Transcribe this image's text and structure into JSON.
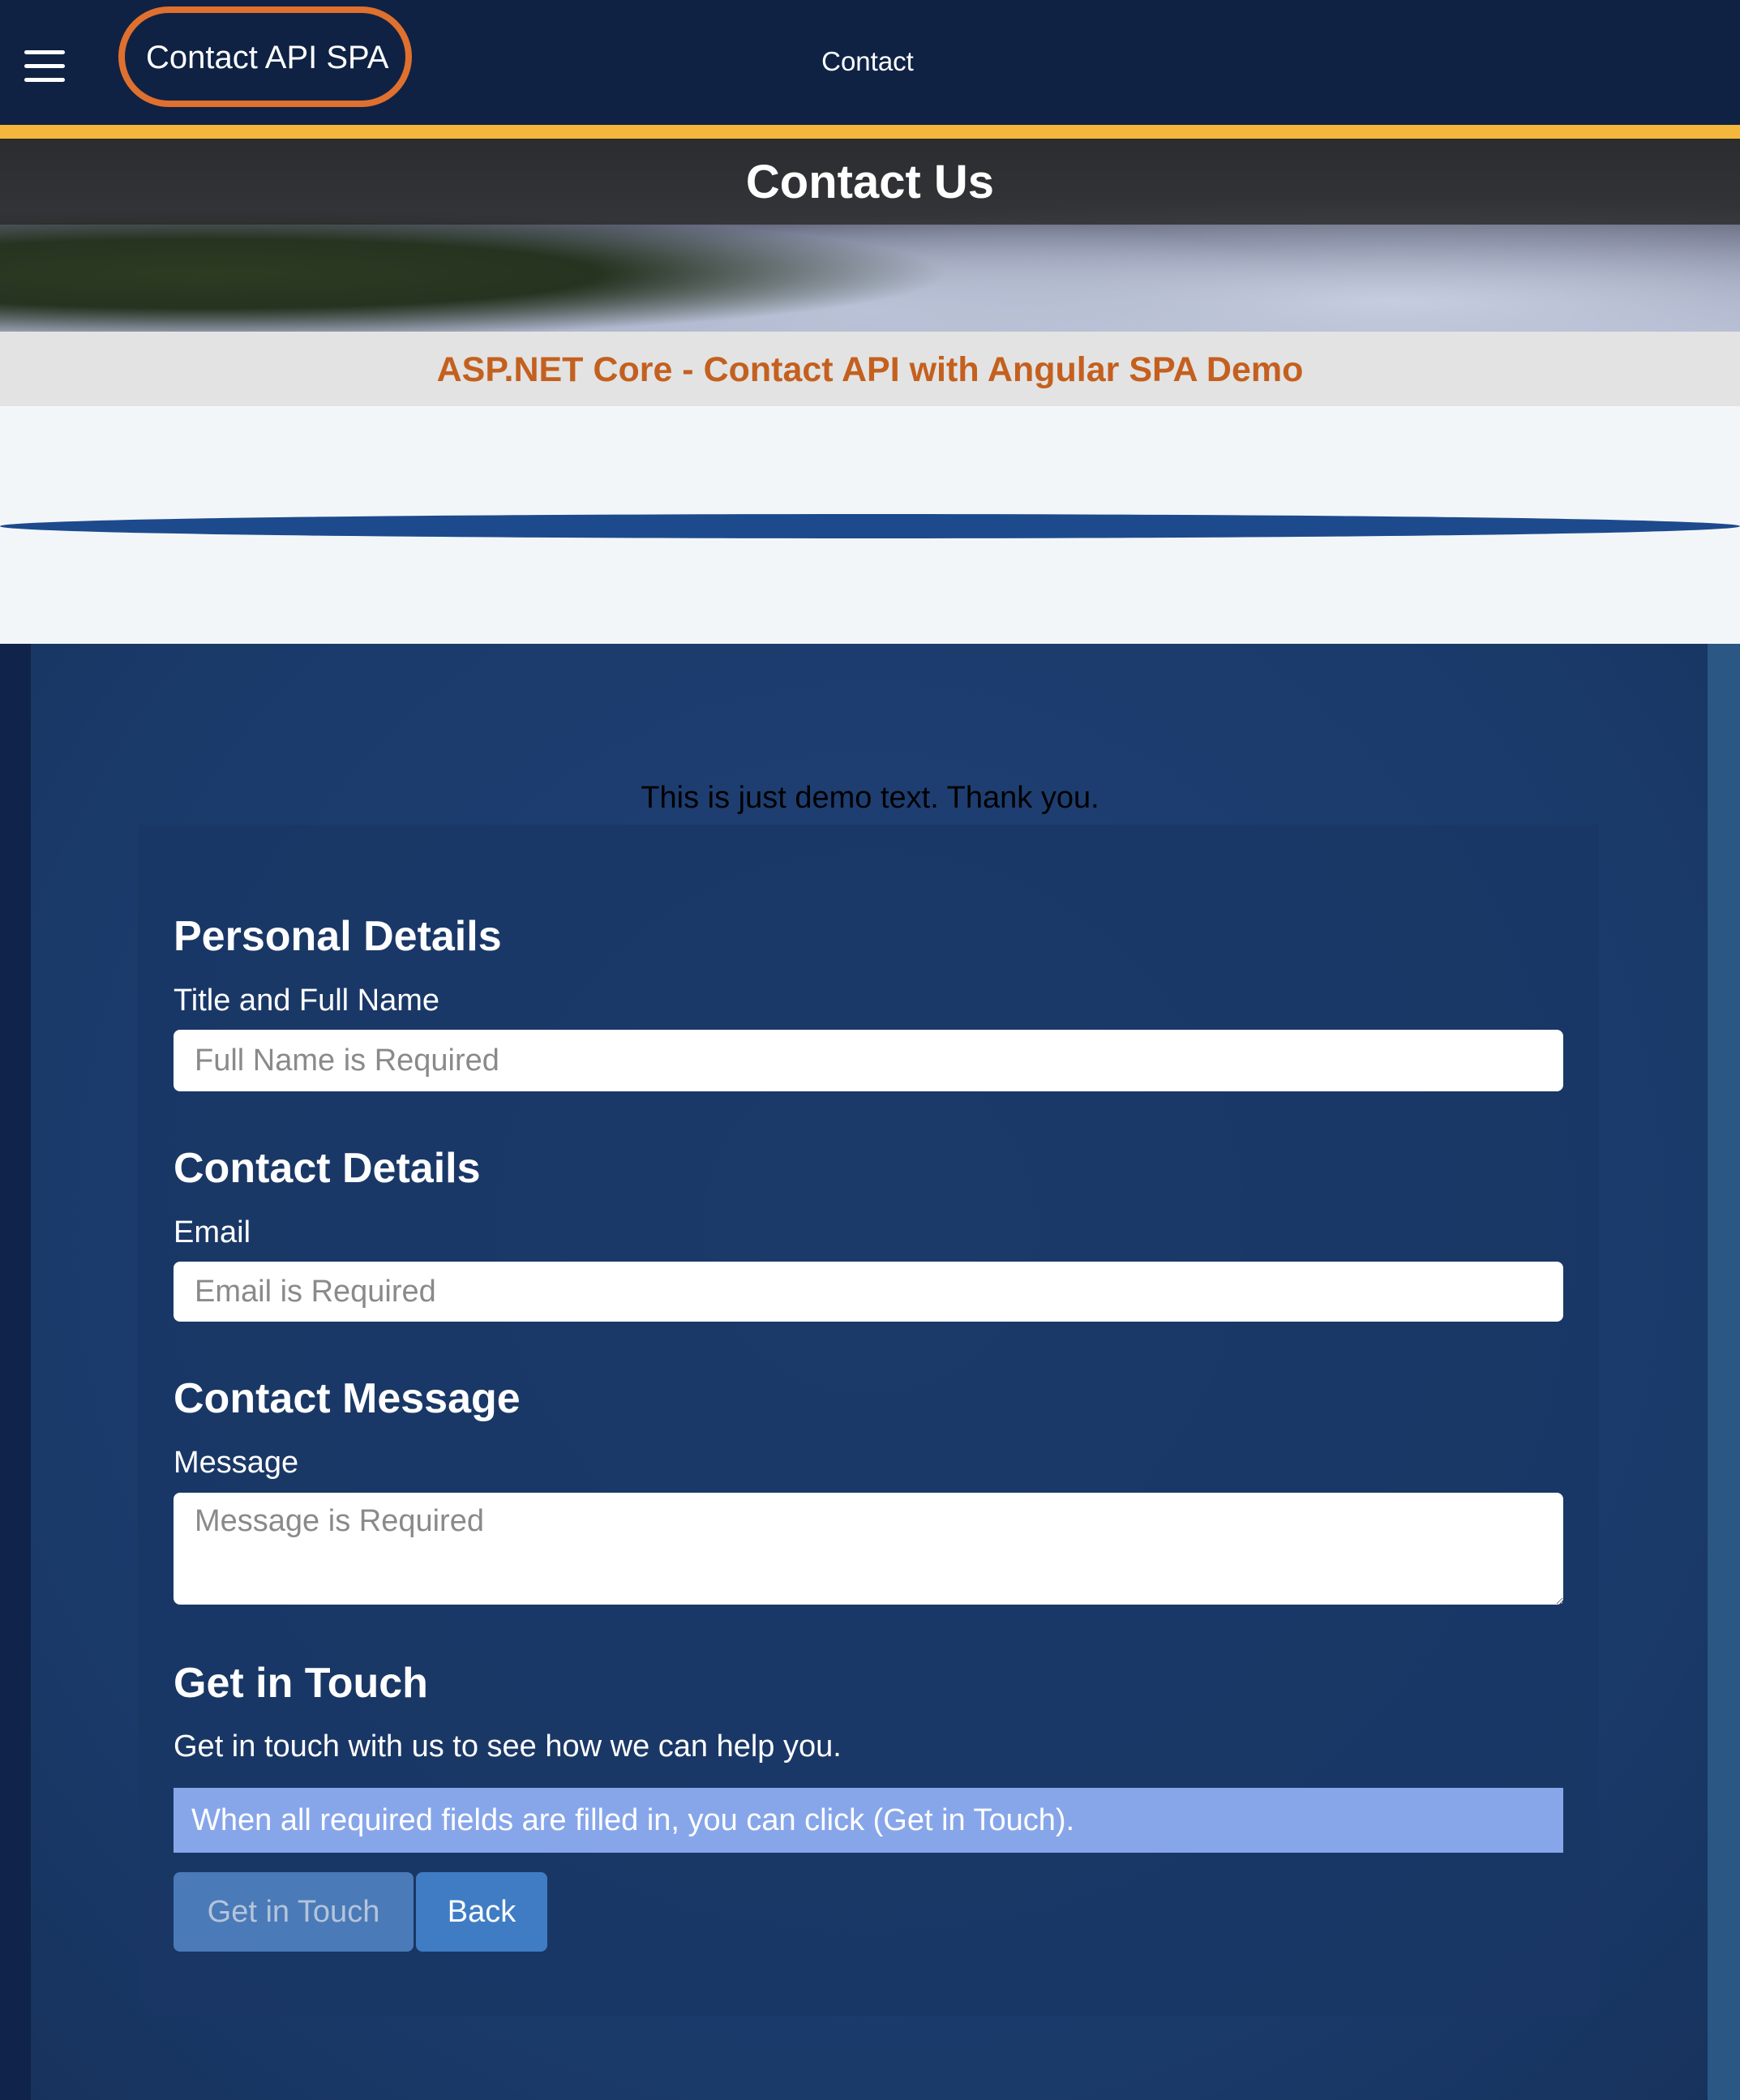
{
  "header": {
    "brand": "Contact API SPA",
    "nav_link": "Contact"
  },
  "hero": {
    "title": "Contact Us",
    "subtitle": "ASP.NET Core - Contact API with Angular SPA Demo"
  },
  "main": {
    "demo_text": "This is just demo text. Thank you."
  },
  "form": {
    "personal_heading": "Personal Details",
    "name_label": "Title and Full Name",
    "name_placeholder": "Full Name is Required",
    "contact_heading": "Contact Details",
    "email_label": "Email",
    "email_placeholder": "Email is Required",
    "message_heading": "Contact Message",
    "message_label": "Message",
    "message_placeholder": "Message is Required",
    "touch_heading": "Get in Touch",
    "touch_text": "Get in touch with us to see how we can help you.",
    "info": "When all required fields are filled in, you can click (Get in Touch).",
    "submit_label": "Get in Touch",
    "back_label": "Back"
  },
  "colors": {
    "navbar": "#0f2244",
    "stripe": "#f4b73c",
    "brand_outline": "#e0702e",
    "subtitle": "#c4601f",
    "info_bar": "#87a6ea"
  }
}
